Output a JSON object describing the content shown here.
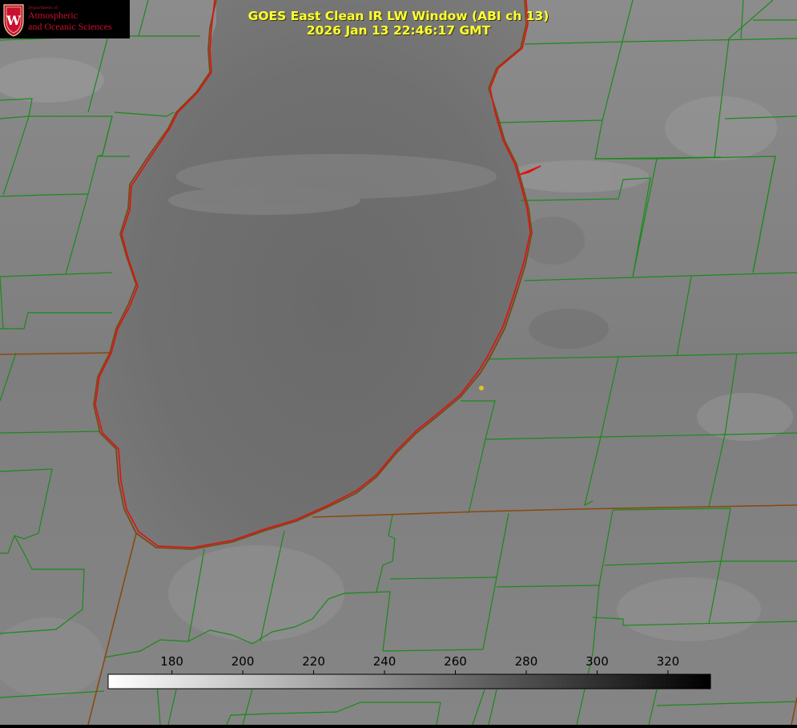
{
  "map": {
    "title": "GOES East Clean IR LW Window (ABI ch 13)",
    "timestamp": "2026 Jan 13 22:46:17 GMT",
    "logo": {
      "department": "Department of",
      "line1": "Atmospheric",
      "line2": "and Oceanic Sciences",
      "seal_letter": "W"
    },
    "colors": {
      "title": "#ffff33",
      "county_lines": "#1a8a1a",
      "coastline": "#e01010",
      "state_line": "#8a4a10",
      "marker": "#e0c020",
      "logo_text": "#c9102f"
    }
  },
  "colorbar": {
    "ticks": [
      180,
      200,
      220,
      240,
      260,
      280,
      300,
      320
    ],
    "range": [
      162,
      332
    ],
    "gradient": "white-to-black"
  }
}
